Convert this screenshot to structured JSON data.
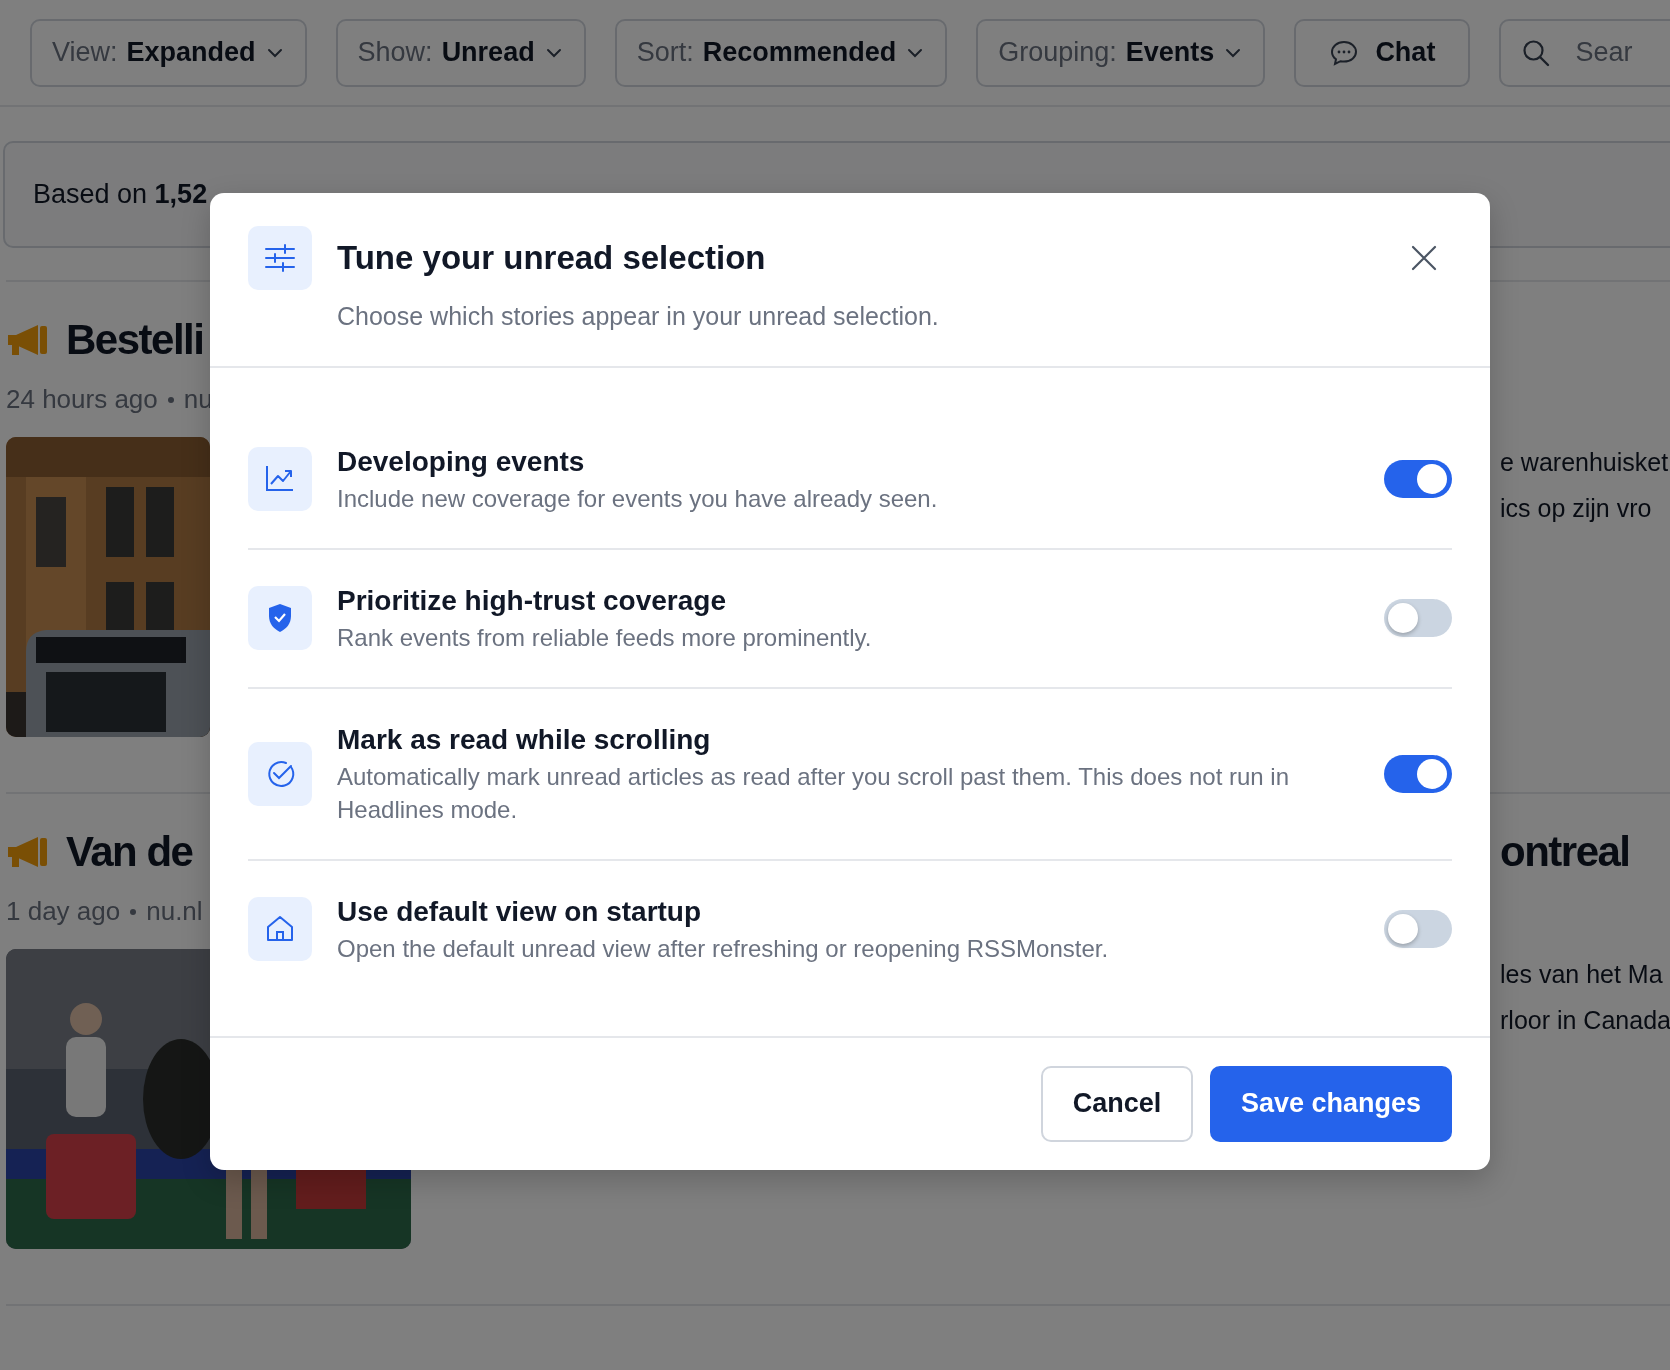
{
  "toolbar": {
    "filters": [
      {
        "label": "View:",
        "value": "Expanded"
      },
      {
        "label": "Show:",
        "value": "Unread"
      },
      {
        "label": "Sort:",
        "value": "Recommended"
      },
      {
        "label": "Grouping:",
        "value": "Events"
      }
    ],
    "chat_button": "Chat",
    "search": {
      "placeholder": "Sear"
    }
  },
  "summary": "Based on **1,52**",
  "articles": [
    {
      "title": "Bestelli",
      "time": "24 hours ago",
      "source": "nu",
      "excerpt_lines": [
        "e warenhuisket",
        "ics op zijn vro"
      ]
    },
    {
      "title": "Van de",
      "title_end": "ontreal",
      "time": "1 day ago",
      "source": "nu.nl",
      "excerpt_lines": [
        "les van het Ma",
        "rloor in Canada"
      ]
    }
  ],
  "modal": {
    "title": "Tune your unread selection",
    "subtitle": "Choose which stories appear in your unread selection.",
    "options": [
      {
        "title": "Developing events",
        "description": "Include new coverage for events you have already seen.",
        "on": true
      },
      {
        "title": "Prioritize high-trust coverage",
        "description": "Rank events from reliable feeds more prominently.",
        "on": false
      },
      {
        "title": "Mark as read while scrolling",
        "description": "Automatically mark unread articles as read after you scroll past them. This does not run in Headlines mode.",
        "on": true
      },
      {
        "title": "Use default view on startup",
        "description": "Open the default unread view after refreshing or reopening RSSMonster.",
        "on": false
      }
    ],
    "cancel": "Cancel",
    "save": "Save changes"
  }
}
